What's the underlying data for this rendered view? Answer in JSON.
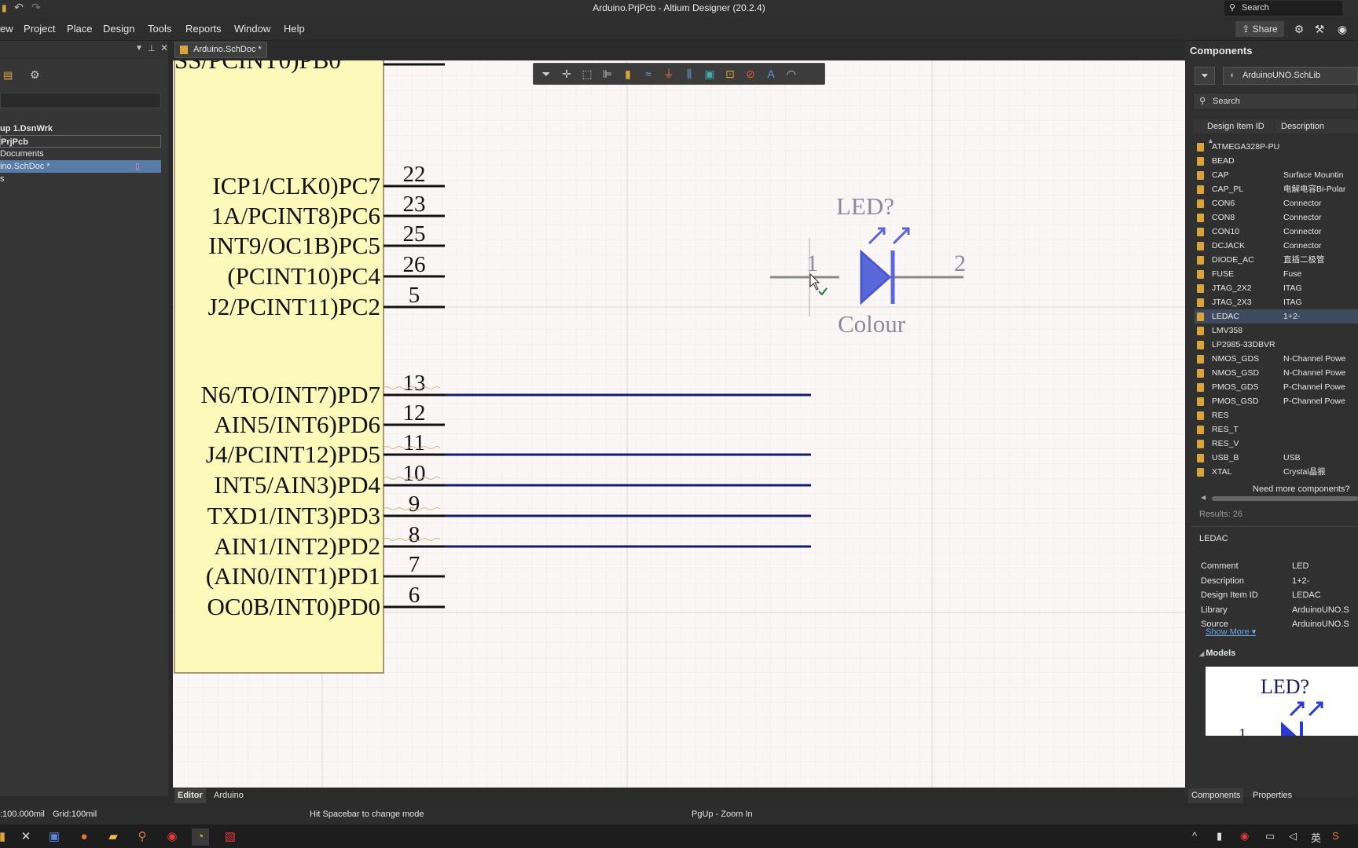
{
  "window": {
    "title": "Arduino.PrjPcb - Altium Designer (20.2.4)",
    "search_placeholder": "Search"
  },
  "menu": [
    "ew",
    "Project",
    "Place",
    "Design",
    "Tools",
    "Reports",
    "Window",
    "Help"
  ],
  "share_label": "Share",
  "left_panel": {
    "rows": [
      "up 1.DsnWrk",
      "PrjPcb",
      "Documents",
      "ino.SchDoc *",
      "s"
    ]
  },
  "doc_tab": "Arduino.SchDoc *",
  "schematic": {
    "top_pin_label": "SS/PCINT0)PB0",
    "pins": [
      {
        "label": "ICP1/CLK0)PC7",
        "number": "22",
        "wired": false
      },
      {
        "label": "1A/PCINT8)PC6",
        "number": "23",
        "wired": false
      },
      {
        "label": "INT9/OC1B)PC5",
        "number": "25",
        "wired": false
      },
      {
        "label": "(PCINT10)PC4",
        "number": "26",
        "wired": false
      },
      {
        "label": "J2/PCINT11)PC2",
        "number": "5",
        "wired": false
      },
      {
        "label": "N6/TO/INT7)PD7",
        "number": "13",
        "wired": true
      },
      {
        "label": "AIN5/INT6)PD6",
        "number": "12",
        "wired": false
      },
      {
        "label": "J4/PCINT12)PD5",
        "number": "11",
        "wired": true
      },
      {
        "label": "INT5/AIN3)PD4",
        "number": "10",
        "wired": true
      },
      {
        "label": "TXD1/INT3)PD3",
        "number": "9",
        "wired": true
      },
      {
        "label": "AIN1/INT2)PD2",
        "number": "8",
        "wired": true
      },
      {
        "label": "(AIN0/INT1)PD1",
        "number": "7",
        "wired": false
      },
      {
        "label": "OC0B/INT0)PD0",
        "number": "6",
        "wired": false
      }
    ],
    "led": {
      "designator": "LED?",
      "comment": "Colour",
      "pin1": "1",
      "pin2": "2"
    }
  },
  "components_panel": {
    "title": "Components",
    "library": "ArduinoUNO.SchLib",
    "search_placeholder": "Search",
    "columns": [
      "Design Item ID",
      "Description"
    ],
    "rows": [
      {
        "id": "ATMEGA328P-PU",
        "desc": ""
      },
      {
        "id": "BEAD",
        "desc": ""
      },
      {
        "id": "CAP",
        "desc": "Surface Mountin"
      },
      {
        "id": "CAP_PL",
        "desc": "电解电容Bi-Polar"
      },
      {
        "id": "CON6",
        "desc": "Connector"
      },
      {
        "id": "CON8",
        "desc": "Connector"
      },
      {
        "id": "CON10",
        "desc": "Connector"
      },
      {
        "id": "DCJACK",
        "desc": "Connector"
      },
      {
        "id": "DIODE_AC",
        "desc": "直插二极管"
      },
      {
        "id": "FUSE",
        "desc": "Fuse"
      },
      {
        "id": "JTAG_2X2",
        "desc": "ITAG"
      },
      {
        "id": "JTAG_2X3",
        "desc": "ITAG"
      },
      {
        "id": "LEDAC",
        "desc": "1+2-",
        "selected": true
      },
      {
        "id": "LMV358",
        "desc": ""
      },
      {
        "id": "LP2985-33DBVR",
        "desc": ""
      },
      {
        "id": "NMOS_GDS",
        "desc": "N-Channel Powe"
      },
      {
        "id": "NMOS_GSD",
        "desc": "N-Channel Powe"
      },
      {
        "id": "PMOS_GDS",
        "desc": "P-Channel Powe"
      },
      {
        "id": "PMOS_GSD",
        "desc": "P-Channel Powe"
      },
      {
        "id": "RES",
        "desc": ""
      },
      {
        "id": "RES_T",
        "desc": ""
      },
      {
        "id": "RES_V",
        "desc": ""
      },
      {
        "id": "USB_B",
        "desc": "USB"
      },
      {
        "id": "XTAL",
        "desc": "Crystal晶振"
      }
    ],
    "need_more": "Need more components?",
    "results": "Results: 26",
    "selected_name": "LEDAC",
    "properties": [
      {
        "k": "Comment",
        "v": "LED"
      },
      {
        "k": "Description",
        "v": "1+2-"
      },
      {
        "k": "Design Item ID",
        "v": "LEDAC"
      },
      {
        "k": "Library",
        "v": "ArduinoUNO.S"
      },
      {
        "k": "Source",
        "v": "ArduinoUNO.S"
      }
    ],
    "show_more": "Show More ▾",
    "models_label": "Models",
    "preview": {
      "designator": "LED?",
      "pin1": "1"
    }
  },
  "bottom_tabs": {
    "left": [
      "Editor",
      "Arduino"
    ],
    "right": [
      "Components",
      "Properties"
    ]
  },
  "status": {
    "coords": ":100.000mil",
    "grid": "Grid:100mil",
    "hint": "Hit Spacebar to change mode",
    "zoom": "PgUp - Zoom In"
  },
  "taskbar_right": [
    "^",
    "英"
  ],
  "colors": {
    "body_fill": "#fdf9ba",
    "wire": "#101e6b",
    "led": "#5a67d9",
    "selection": "#3f4a5e"
  }
}
